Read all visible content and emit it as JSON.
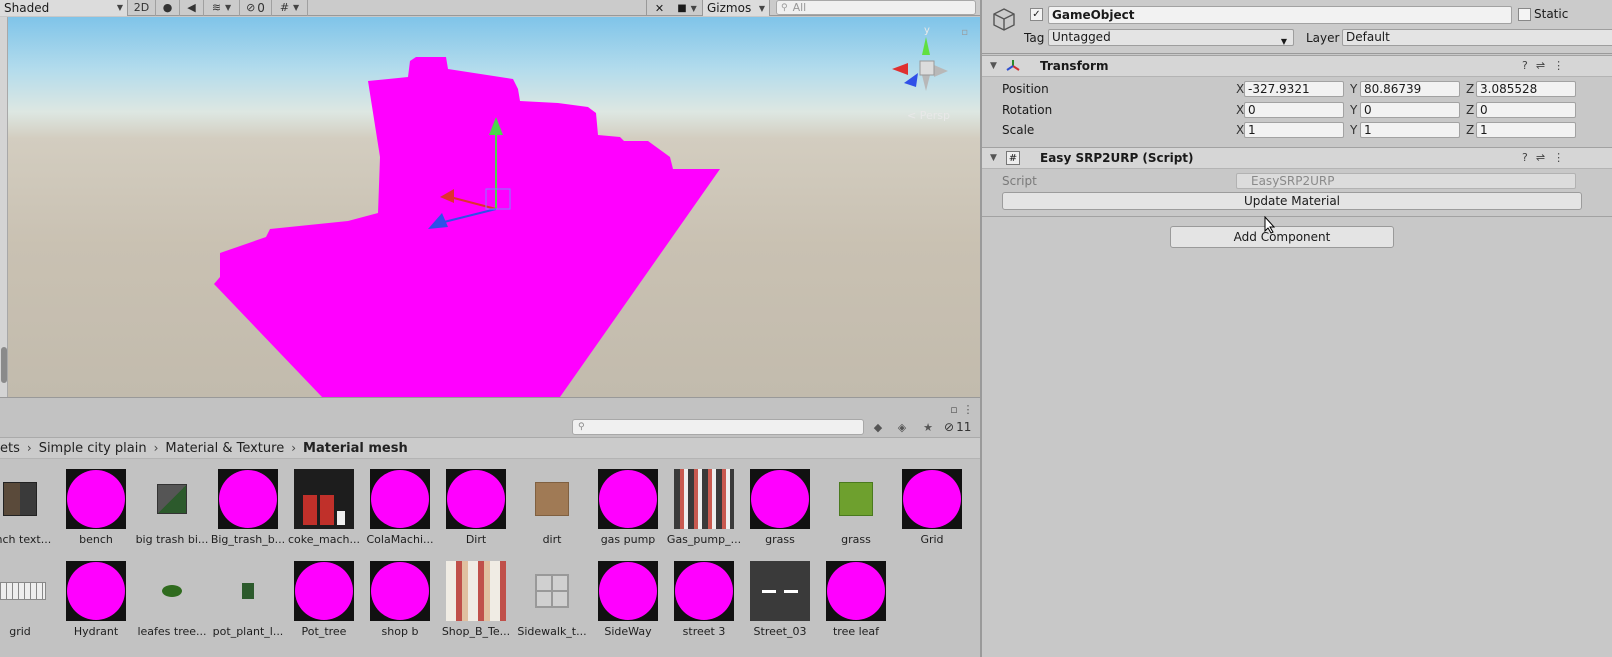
{
  "scene": {
    "toolbar": {
      "shading_mode": "Shaded",
      "mode_2d": "2D",
      "hidden_count": "0",
      "gizmos_label": "Gizmos",
      "search_placeholder": "All"
    },
    "persp_label": "< Persp",
    "gizmo_axis_label": "y"
  },
  "project": {
    "hidden_count": "11",
    "breadcrumb": [
      "ets",
      "Simple city plain",
      "Material & Texture",
      "Material mesh"
    ],
    "assets_row1": [
      {
        "label": "ench text...",
        "thumb": "texture-dark"
      },
      {
        "label": "bench",
        "thumb": "magenta"
      },
      {
        "label": "big trash bi...",
        "thumb": "mesh-bin"
      },
      {
        "label": "Big_trash_b...",
        "thumb": "magenta"
      },
      {
        "label": "coke_mach...",
        "thumb": "texture-coke"
      },
      {
        "label": "ColaMachi...",
        "thumb": "magenta"
      },
      {
        "label": "Dirt",
        "thumb": "magenta"
      },
      {
        "label": "dirt",
        "thumb": "texture-dirt"
      },
      {
        "label": "gas pump",
        "thumb": "magenta"
      },
      {
        "label": "Gas_pump_...",
        "thumb": "texture-atlas"
      },
      {
        "label": "grass",
        "thumb": "magenta"
      },
      {
        "label": "grass",
        "thumb": "texture-grass"
      },
      {
        "label": "Grid",
        "thumb": "magenta"
      }
    ],
    "assets_row2": [
      {
        "label": "grid",
        "thumb": "texture-grid"
      },
      {
        "label": "Hydrant",
        "thumb": "magenta"
      },
      {
        "label": "leafes tree...",
        "thumb": "mesh-leaf"
      },
      {
        "label": "pot_plant_l...",
        "thumb": "mesh-plant"
      },
      {
        "label": "Pot_tree",
        "thumb": "magenta"
      },
      {
        "label": "shop b",
        "thumb": "magenta"
      },
      {
        "label": "Shop_B_Te...",
        "thumb": "texture-shop"
      },
      {
        "label": "Sidewalk_t...",
        "thumb": "texture-sidewalk"
      },
      {
        "label": "SideWay",
        "thumb": "magenta"
      },
      {
        "label": "street 3",
        "thumb": "magenta"
      },
      {
        "label": "Street_03",
        "thumb": "texture-street"
      },
      {
        "label": "tree leaf",
        "thumb": "magenta"
      }
    ]
  },
  "inspector": {
    "object_name": "GameObject",
    "static_label": "Static",
    "tag_label": "Tag",
    "tag_value": "Untagged",
    "layer_label": "Layer",
    "layer_value": "Default",
    "transform": {
      "title": "Transform",
      "position_label": "Position",
      "rotation_label": "Rotation",
      "scale_label": "Scale",
      "position": {
        "x": "-327.9321",
        "y": "80.86739",
        "z": "3.085528"
      },
      "rotation": {
        "x": "0",
        "y": "0",
        "z": "0"
      },
      "scale": {
        "x": "1",
        "y": "1",
        "z": "1"
      },
      "axis_x": "X",
      "axis_y": "Y",
      "axis_z": "Z"
    },
    "script_component": {
      "title": "Easy SRP2URP (Script)",
      "script_label": "Script",
      "script_value": "EasySRP2URP",
      "update_button": "Update Material"
    },
    "add_component_button": "Add Component"
  },
  "colors": {
    "magenta_material": "#ff00ff",
    "sky_top": "#7fc4e9",
    "ground": "#c9c1b2"
  }
}
